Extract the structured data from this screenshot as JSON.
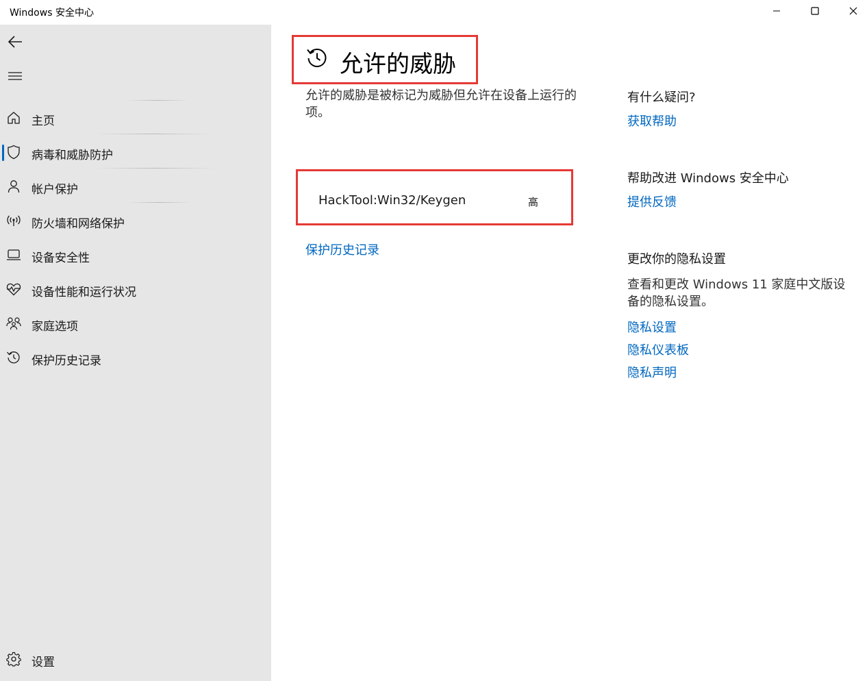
{
  "window": {
    "title": "Windows 安全中心"
  },
  "sidebar": {
    "items": [
      {
        "label": "主页",
        "icon": "home-icon"
      },
      {
        "label": "病毒和威胁防护",
        "icon": "shield-icon",
        "active": true
      },
      {
        "label": "帐户保护",
        "icon": "person-icon"
      },
      {
        "label": "防火墙和网络保护",
        "icon": "wireless-icon"
      },
      {
        "label": "设备安全性",
        "icon": "laptop-icon"
      },
      {
        "label": "设备性能和运行状况",
        "icon": "heart-pulse-icon"
      },
      {
        "label": "家庭选项",
        "icon": "family-icon"
      },
      {
        "label": "保护历史记录",
        "icon": "history-icon"
      }
    ],
    "settings_label": "设置"
  },
  "main": {
    "title": "允许的威胁",
    "description": "允许的威胁是被标记为威胁但允许在设备上运行的项。",
    "threats": [
      {
        "name": "HackTool:Win32/Keygen",
        "level": "高"
      }
    ],
    "history_link": "保护历史记录"
  },
  "side": {
    "question_heading": "有什么疑问?",
    "help_link": "获取帮助",
    "improve_heading": "帮助改进 Windows 安全中心",
    "feedback_link": "提供反馈",
    "privacy_heading": "更改你的隐私设置",
    "privacy_desc": "查看和更改 Windows 11 家庭中文版设备的隐私设置。",
    "privacy_links": [
      "隐私设置",
      "隐私仪表板",
      "隐私声明"
    ]
  },
  "colors": {
    "accent": "#0067c0",
    "highlight_border": "#e53935",
    "sidebar_bg": "#e6e6e6"
  }
}
